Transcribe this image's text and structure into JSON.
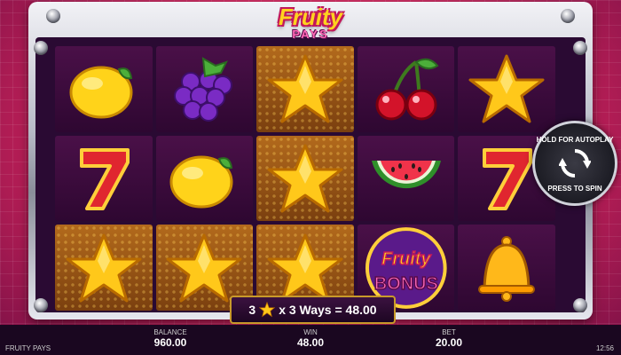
{
  "logo": {
    "line1": "Fruity",
    "line2": "PAYS"
  },
  "reels": [
    [
      "lemon",
      "seven",
      "star"
    ],
    [
      "grapes",
      "lemon",
      "star"
    ],
    [
      "star",
      "star",
      "star"
    ],
    [
      "cherry",
      "watermelon",
      "bonus"
    ],
    [
      "star",
      "seven",
      "bell"
    ]
  ],
  "win_cells": [
    [
      0,
      2
    ],
    [
      1,
      2
    ],
    [
      2,
      0
    ],
    [
      2,
      1
    ],
    [
      2,
      2
    ]
  ],
  "bonus_symbol": {
    "line1": "Fruity",
    "line2": "BONUS"
  },
  "autoplay": {
    "top": "HOLD FOR AUTOPLAY",
    "bottom": "PRESS TO SPIN"
  },
  "win_banner": {
    "count": "3",
    "text": "x 3 Ways = 48.00"
  },
  "bottom_bar": {
    "game_name": "FRUITY PAYS",
    "balance_label": "BALANCE",
    "balance": "960.00",
    "win_label": "WIN",
    "win": "48.00",
    "bet_label": "BET",
    "bet": "20.00",
    "clock": "12:56"
  },
  "colors": {
    "accent": "#ffd21f",
    "frame": "#b9bcc8",
    "background": "#d9265f"
  }
}
